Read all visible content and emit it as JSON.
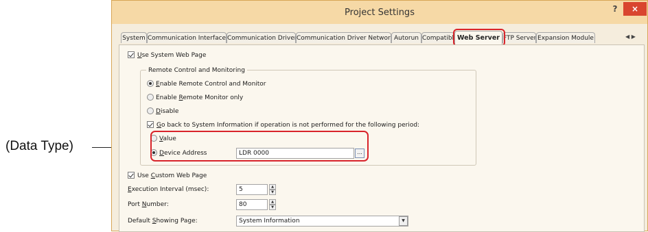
{
  "callout": {
    "label": "(Data Type)"
  },
  "window": {
    "title": "Project Settings",
    "help": "?",
    "close": "×"
  },
  "tabs": [
    {
      "label": "System"
    },
    {
      "label": "Communication Interface"
    },
    {
      "label": "Communication Driver"
    },
    {
      "label": "Communication Driver Network"
    },
    {
      "label": "Autorun"
    },
    {
      "label": "Compatible"
    },
    {
      "label": "Web Server",
      "active": true
    },
    {
      "label": "FTP Server"
    },
    {
      "label": "Expansion Module"
    }
  ],
  "tab_scroll": "◀ ▶",
  "web_server": {
    "use_system_web_page": {
      "pre": "",
      "ul": "U",
      "post": "se System Web Page",
      "checked": true
    },
    "remote_group": {
      "title": "Remote Control and Monitoring",
      "options": [
        {
          "pre": "",
          "ul": "E",
          "post": "nable Remote Control and Monitor",
          "selected": true
        },
        {
          "pre": "Enable ",
          "ul": "R",
          "post": "emote Monitor only",
          "selected": false
        },
        {
          "pre": "",
          "ul": "D",
          "post": "isable",
          "selected": false
        }
      ],
      "go_back": {
        "pre": "",
        "ul": "G",
        "post": "o back to System Information if operation is not performed for the following period:",
        "checked": true
      }
    },
    "data_type": {
      "value": {
        "pre": "",
        "ul": "V",
        "post": "alue",
        "selected": false
      },
      "device_address": {
        "pre": "",
        "ul": "D",
        "post": "evice Address",
        "selected": true
      },
      "device_address_value": "LDR 0000",
      "browse": "..."
    },
    "use_custom_web_page": {
      "pre": "Use ",
      "ul": "C",
      "post": "ustom Web Page",
      "checked": true
    },
    "execution_interval": {
      "pre": "",
      "ul": "E",
      "post": "xecution Interval (msec):",
      "value": "5"
    },
    "port_number": {
      "pre": "Port ",
      "ul": "N",
      "post": "umber:",
      "value": "80"
    },
    "default_showing_page": {
      "pre": "Default ",
      "ul": "S",
      "post": "howing Page:",
      "value": "System Information"
    }
  }
}
